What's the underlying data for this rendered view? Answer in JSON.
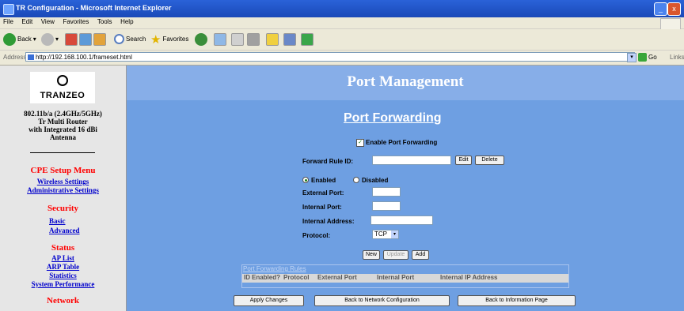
{
  "window": {
    "title": "TR Configuration - Microsoft Internet Explorer",
    "min_label": "_",
    "close_label": "x"
  },
  "menubar": [
    "File",
    "Edit",
    "View",
    "Favorites",
    "Tools",
    "Help"
  ],
  "toolbar": {
    "back": "Back",
    "search": "Search",
    "favorites": "Favorites"
  },
  "address": {
    "label": "Address",
    "url": "http://192.168.100.1/frameset.html",
    "go": "Go",
    "links": "Links"
  },
  "sidebar": {
    "brand": "TRANZEO",
    "description": [
      "802.11b/a (2.4GHz/5GHz)",
      "Tr Multi Router",
      "with Integrated 16 dBi",
      "Antenna"
    ],
    "menu_title": "CPE Setup Menu",
    "links_top": [
      "Wireless Settings",
      "Administrative Settings"
    ],
    "security_title": "Security",
    "security_links": [
      "Basic",
      "Advanced"
    ],
    "status_title": "Status",
    "status_links": [
      "AP List",
      "ARP Table",
      "Statistics",
      "System Performance"
    ],
    "network_title": "Network"
  },
  "main": {
    "page_title": "Port Management",
    "section_title": "Port Forwarding",
    "enable_label": "Enable Port Forwarding",
    "enable_checked": true,
    "rule_id_label": "Forward Rule ID:",
    "rule_id_value": "",
    "edit_button": "Edit",
    "delete_button": "Delete",
    "enabled_label": "Enabled",
    "disabled_label": "Disabled",
    "external_port_label": "External Port:",
    "internal_port_label": "Internal Port:",
    "internal_address_label": "Internal Address:",
    "protocol_label": "Protocol:",
    "protocol_value": "TCP",
    "new_button": "New",
    "update_button": "Update",
    "add_button": "Add",
    "rules_title": "Port Forwarding Rules",
    "rules_columns": [
      "ID",
      "Enabled?",
      "Protocol",
      "External Port",
      "Internal Port",
      "Internal IP Address"
    ],
    "apply_button": "Apply Changes",
    "back_network_button": "Back to Network Configuration",
    "back_info_button": "Back to Information Page"
  },
  "colors": {
    "titlebar": "#2a62d8",
    "main_bg": "#6e9fe2",
    "menu_heading": "#ff0000",
    "menu_link": "#0000cc"
  }
}
